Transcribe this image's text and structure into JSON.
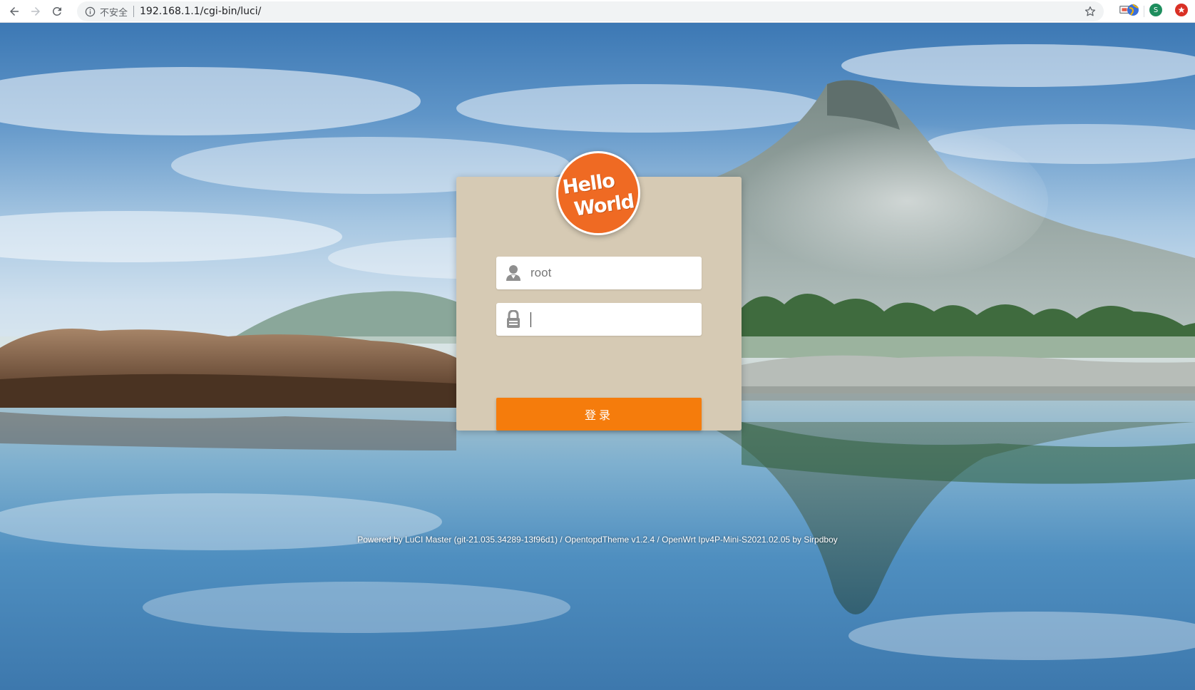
{
  "browser": {
    "security_label": "不安全",
    "url": "192.168.1.1/cgi-bin/luci/",
    "icons": {
      "back": "back-arrow-icon",
      "forward": "forward-arrow-icon",
      "reload": "reload-icon",
      "info": "info-icon",
      "bookmark": "star-icon"
    },
    "extensions": [
      {
        "name": "cast-icon",
        "label": ""
      },
      {
        "name": "extension-globe-icon",
        "label": ""
      },
      {
        "name": "profile-avatar",
        "label": "S"
      },
      {
        "name": "extension-red-icon",
        "label": ""
      }
    ]
  },
  "login": {
    "logo_line1": "Hello",
    "logo_line2": "World",
    "username_value": "root",
    "password_value": "",
    "submit_label": "登录",
    "user_icon": "user-icon",
    "lock_icon": "lock-icon"
  },
  "footer": {
    "text": "Powered by LuCI Master (git-21.035.34289-13f96d1) / OpentopdTheme v1.2.4 / OpenWrt Ipv4P-Mini-S2021.02.05 by Sirpdboy"
  },
  "colors": {
    "card_bg": "#d6cab4",
    "accent": "#f57c0c",
    "logo_bg": "#ef6a23"
  }
}
